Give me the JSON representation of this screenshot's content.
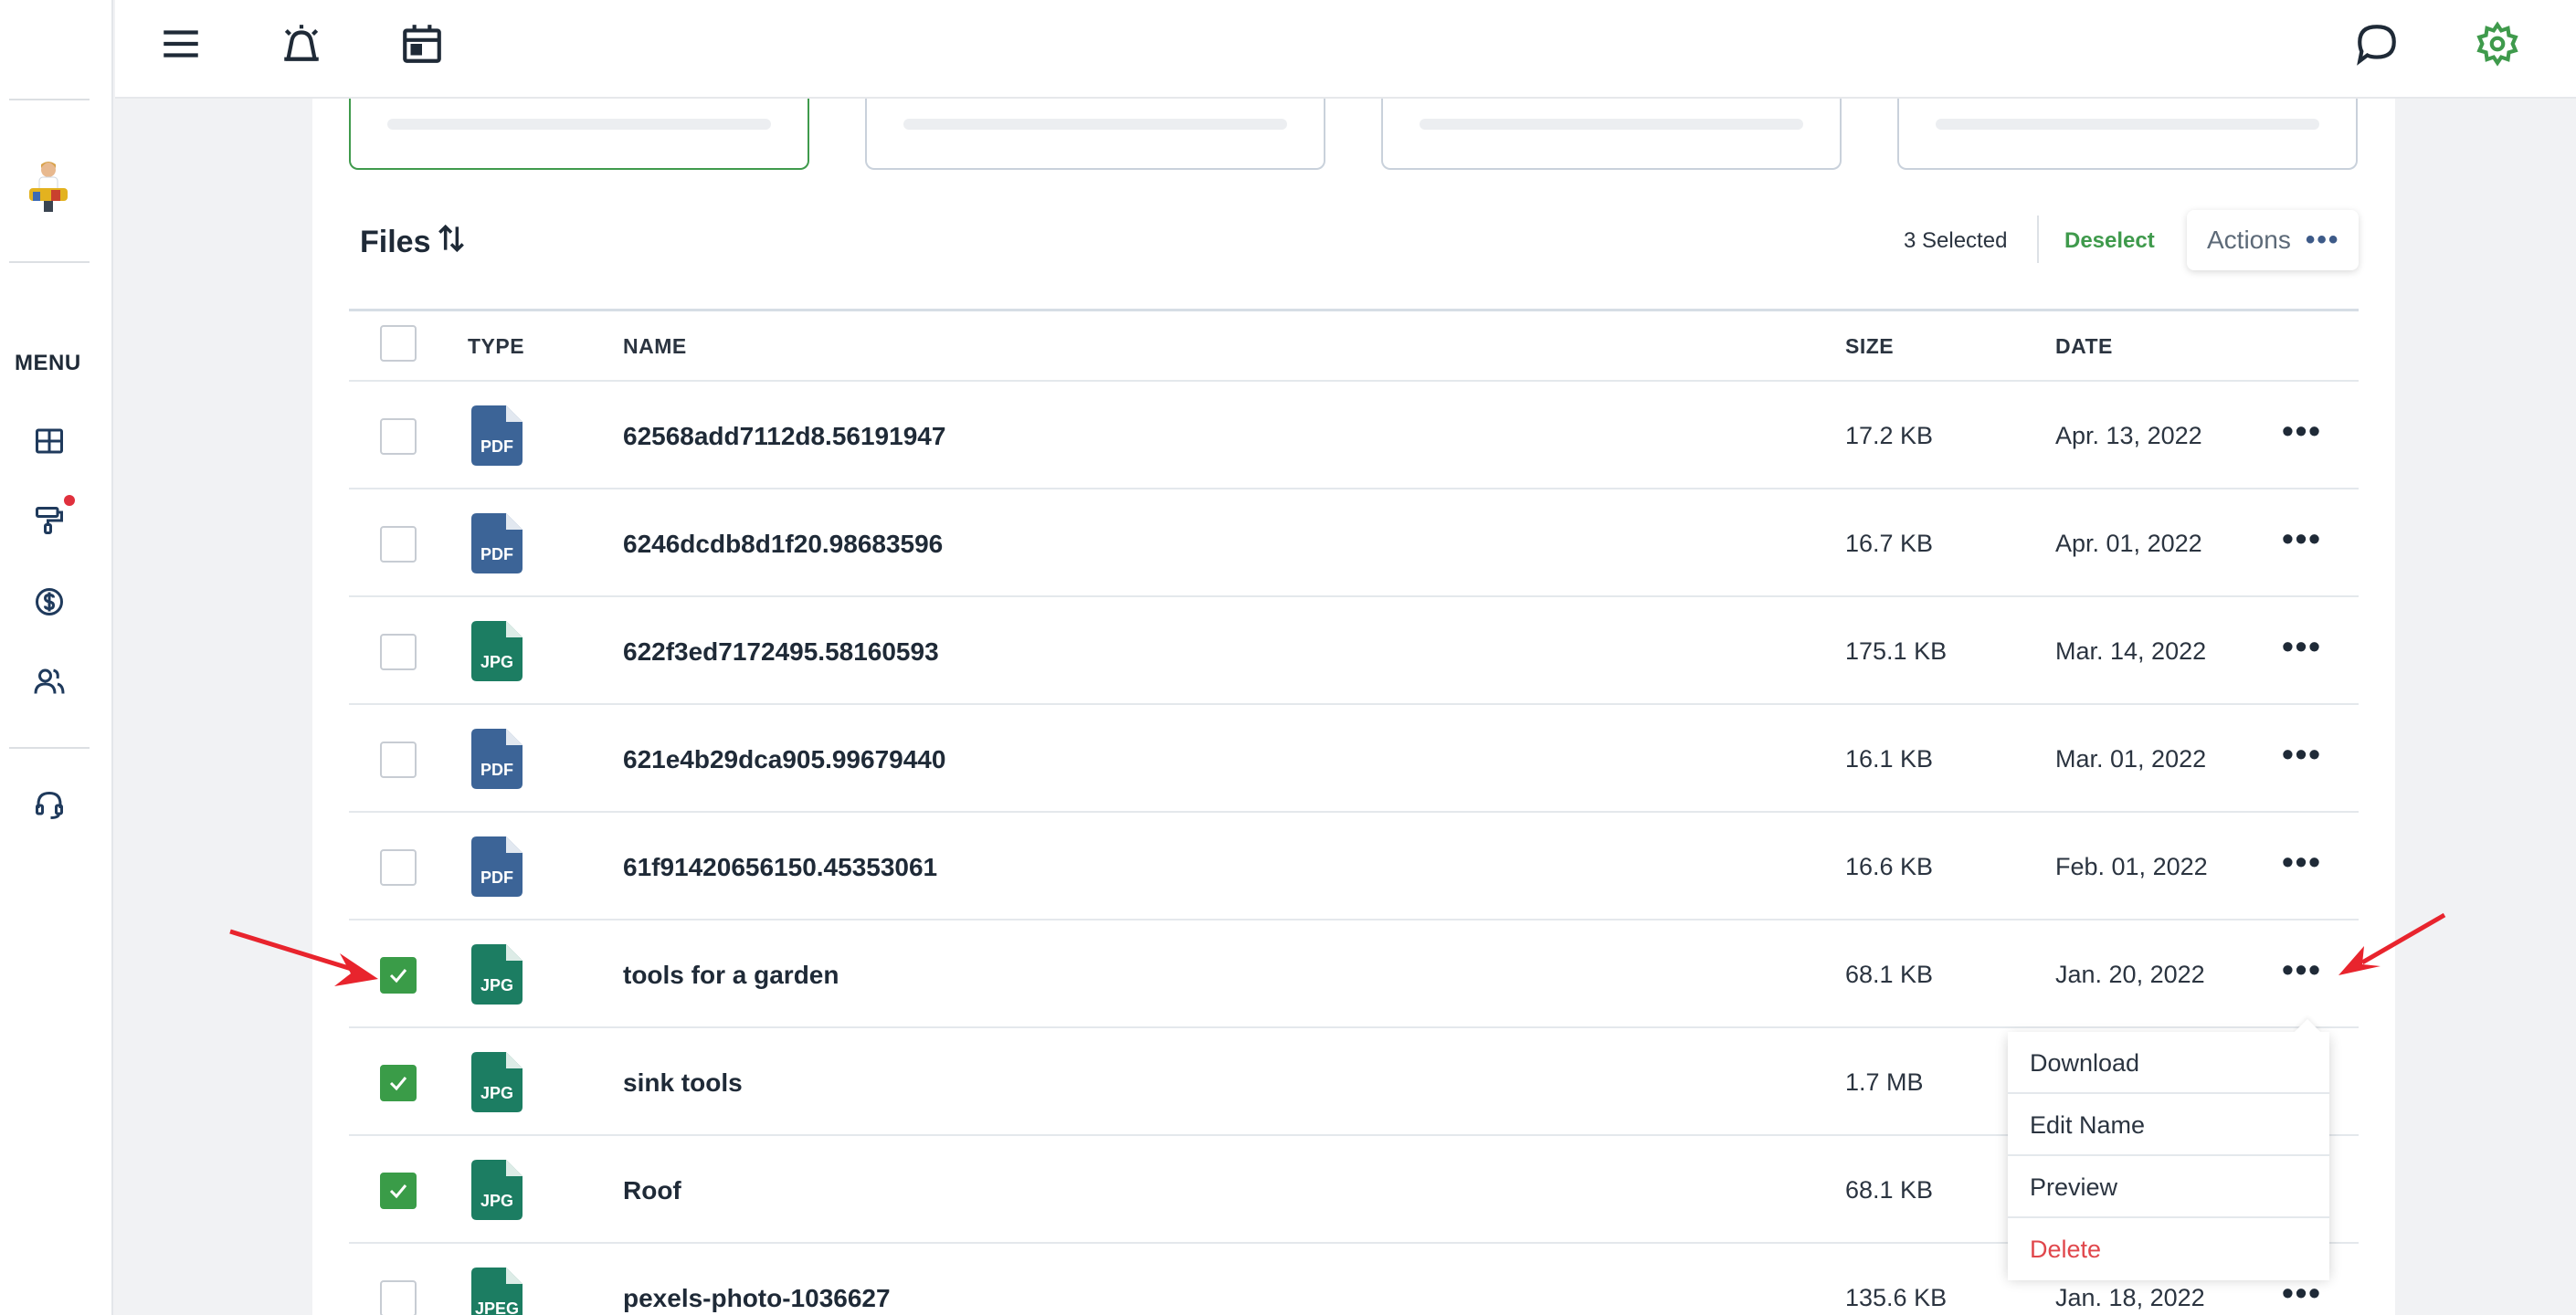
{
  "sidebar": {
    "menu_label": "MENU",
    "icons": [
      "dashboard-icon",
      "paint-roller-icon",
      "dollar-icon",
      "users-icon",
      "headset-icon"
    ]
  },
  "header": {
    "icons": [
      "hamburger-menu-icon",
      "alarm-icon",
      "calendar-icon",
      "chat-icon",
      "gear-icon"
    ],
    "accent_color": "#3f9a4c"
  },
  "files": {
    "title": "Files",
    "selected_count_text": "3 Selected",
    "deselect_label": "Deselect",
    "actions_label": "Actions",
    "more_glyph": "•••",
    "columns": {
      "type": "TYPE",
      "name": "NAME",
      "size": "SIZE",
      "date": "DATE"
    },
    "rows": [
      {
        "checked": false,
        "type": "PDF",
        "name": "62568add7112d8.56191947",
        "size": "17.2 KB",
        "date": "Apr. 13, 2022"
      },
      {
        "checked": false,
        "type": "PDF",
        "name": "6246dcdb8d1f20.98683596",
        "size": "16.7 KB",
        "date": "Apr. 01, 2022"
      },
      {
        "checked": false,
        "type": "JPG",
        "name": "622f3ed7172495.58160593",
        "size": "175.1 KB",
        "date": "Mar. 14, 2022"
      },
      {
        "checked": false,
        "type": "PDF",
        "name": "621e4b29dca905.99679440",
        "size": "16.1 KB",
        "date": "Mar. 01, 2022"
      },
      {
        "checked": false,
        "type": "PDF",
        "name": "61f91420656150.45353061",
        "size": "16.6 KB",
        "date": "Feb. 01, 2022"
      },
      {
        "checked": true,
        "type": "JPG",
        "name": "tools for a garden",
        "size": "68.1 KB",
        "date": "Jan. 20, 2022"
      },
      {
        "checked": true,
        "type": "JPG",
        "name": "sink tools",
        "size": "1.7 MB",
        "date": ""
      },
      {
        "checked": true,
        "type": "JPG",
        "name": "Roof",
        "size": "68.1 KB",
        "date": ""
      },
      {
        "checked": false,
        "type": "JPEG",
        "name": "pexels-photo-1036627",
        "size": "135.6 KB",
        "date": "Jan. 18, 2022"
      }
    ]
  },
  "context_menu": {
    "items": [
      "Download",
      "Edit Name",
      "Preview",
      "Delete"
    ]
  },
  "colors": {
    "pdf": "#3c6497",
    "jpg": "#1c7d62",
    "checked": "#3a9c48",
    "danger": "#e0474c",
    "annotation_arrow": "#e8242d"
  }
}
